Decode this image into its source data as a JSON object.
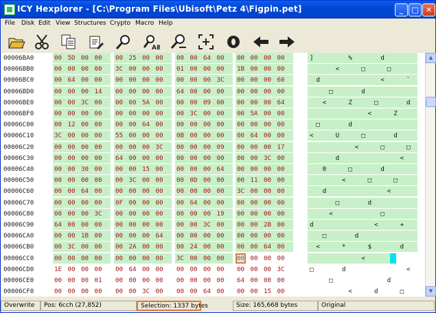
{
  "window": {
    "title": "ICY Hexplorer - [C:\\Program Files\\Ubisoft\\Petz 4\\Figpin.pet]"
  },
  "menu": [
    "File",
    "Disk",
    "Edit",
    "View",
    "Structures",
    "Crypto",
    "Macro",
    "Help"
  ],
  "toolbar": [
    "open-folder-icon",
    "cut-scissors-icon",
    "copy-pages-icon",
    "paste-icon",
    "search-icon",
    "replace-icon",
    "search-next-icon",
    "goto-offset-icon",
    "record-icon",
    "back-arrow-icon",
    "forward-arrow-icon"
  ],
  "colors": {
    "selection_bg": "#c8f0c8",
    "hex_text": "#a31414",
    "cursor": "#e07830",
    "caret": "#00e5f0"
  },
  "hex": {
    "rows": [
      {
        "addr": "00006BA0",
        "g": [
          [
            "00",
            "5D",
            "00",
            "00"
          ],
          [
            "00",
            "25",
            "00",
            "00"
          ],
          [
            "00",
            "00",
            "64",
            "00"
          ],
          [
            "00",
            "00",
            "00",
            "00"
          ]
        ],
        "a": [
          "]",
          "",
          "",
          "",
          "",
          "",
          "%",
          "",
          "",
          "",
          "",
          "d",
          "",
          "",
          "",
          ""
        ]
      },
      {
        "addr": "00006BB0",
        "g": [
          [
            "00",
            "00",
            "00",
            "00"
          ],
          [
            "3C",
            "00",
            "00",
            "00"
          ],
          [
            "01",
            "00",
            "00",
            "00"
          ],
          [
            "1B",
            "00",
            "00",
            "00"
          ]
        ],
        "a": [
          "",
          "",
          "",
          "",
          "<",
          "",
          "",
          "",
          "□",
          "",
          "",
          "",
          "□",
          "",
          "",
          ""
        ]
      },
      {
        "addr": "00006BC0",
        "g": [
          [
            "00",
            "64",
            "00",
            "00"
          ],
          [
            "00",
            "00",
            "00",
            "00"
          ],
          [
            "00",
            "00",
            "00",
            "3C"
          ],
          [
            "00",
            "00",
            "00",
            "60"
          ]
        ],
        "a": [
          "",
          "d",
          "",
          "",
          "",
          "",
          "",
          "",
          "",
          "",
          "",
          "<",
          "",
          "",
          "",
          "`"
        ]
      },
      {
        "addr": "00006BD0",
        "g": [
          [
            "00",
            "00",
            "00",
            "14"
          ],
          [
            "00",
            "00",
            "00",
            "00"
          ],
          [
            "64",
            "00",
            "00",
            "00"
          ],
          [
            "00",
            "00",
            "00",
            "00"
          ]
        ],
        "a": [
          "",
          "",
          "",
          "□",
          "",
          "",
          "",
          "",
          "d",
          "",
          "",
          "",
          "",
          "",
          "",
          ""
        ]
      },
      {
        "addr": "00006BE0",
        "g": [
          [
            "00",
            "00",
            "3C",
            "00"
          ],
          [
            "00",
            "00",
            "5A",
            "00"
          ],
          [
            "00",
            "00",
            "09",
            "00"
          ],
          [
            "00",
            "00",
            "00",
            "64"
          ]
        ],
        "a": [
          "",
          "",
          "<",
          "",
          "",
          "",
          "Z",
          "",
          "",
          "",
          "□",
          "",
          "",
          "",
          "",
          "d"
        ]
      },
      {
        "addr": "00006BF0",
        "g": [
          [
            "00",
            "00",
            "00",
            "00"
          ],
          [
            "00",
            "00",
            "00",
            "00"
          ],
          [
            "00",
            "3C",
            "00",
            "00"
          ],
          [
            "00",
            "5A",
            "00",
            "00"
          ]
        ],
        "a": [
          "",
          "",
          "",
          "",
          "",
          "",
          "",
          "",
          "",
          "<",
          "",
          "",
          "",
          "Z",
          "",
          ""
        ]
      },
      {
        "addr": "00006C00",
        "g": [
          [
            "00",
            "12",
            "00",
            "00"
          ],
          [
            "00",
            "00",
            "64",
            "00"
          ],
          [
            "00",
            "00",
            "00",
            "00"
          ],
          [
            "00",
            "00",
            "00",
            "00"
          ]
        ],
        "a": [
          "",
          "□",
          "",
          "",
          "",
          "",
          "d",
          "",
          "",
          "",
          "",
          "",
          "",
          "",
          "",
          ""
        ]
      },
      {
        "addr": "00006C10",
        "g": [
          [
            "3C",
            "00",
            "00",
            "00"
          ],
          [
            "55",
            "00",
            "00",
            "00"
          ],
          [
            "0B",
            "00",
            "00",
            "00"
          ],
          [
            "00",
            "64",
            "00",
            "00"
          ]
        ],
        "a": [
          "<",
          "",
          "",
          "",
          "U",
          "",
          "",
          "",
          "□",
          "",
          "",
          "",
          "",
          "d",
          "",
          ""
        ]
      },
      {
        "addr": "00006C20",
        "g": [
          [
            "00",
            "00",
            "00",
            "00"
          ],
          [
            "00",
            "00",
            "00",
            "3C"
          ],
          [
            "00",
            "00",
            "00",
            "09"
          ],
          [
            "00",
            "00",
            "00",
            "17"
          ]
        ],
        "a": [
          "",
          "",
          "",
          "",
          "",
          "",
          "",
          "<",
          "",
          "",
          "",
          "□",
          "",
          "",
          "",
          "□"
        ]
      },
      {
        "addr": "00006C30",
        "g": [
          [
            "00",
            "00",
            "00",
            "00"
          ],
          [
            "64",
            "00",
            "00",
            "00"
          ],
          [
            "00",
            "00",
            "00",
            "00"
          ],
          [
            "00",
            "00",
            "3C",
            "00"
          ]
        ],
        "a": [
          "",
          "",
          "",
          "",
          "d",
          "",
          "",
          "",
          "",
          "",
          "",
          "",
          "",
          "",
          "<",
          ""
        ]
      },
      {
        "addr": "00006C40",
        "g": [
          [
            "00",
            "00",
            "30",
            "00"
          ],
          [
            "00",
            "00",
            "15",
            "00"
          ],
          [
            "00",
            "00",
            "00",
            "64"
          ],
          [
            "00",
            "00",
            "00",
            "00"
          ]
        ],
        "a": [
          "",
          "",
          "0",
          "",
          "",
          "",
          "□",
          "",
          "",
          "",
          "",
          "d",
          "",
          "",
          "",
          ""
        ]
      },
      {
        "addr": "00006C50",
        "g": [
          [
            "00",
            "00",
            "00",
            "00"
          ],
          [
            "00",
            "3C",
            "00",
            "00"
          ],
          [
            "00",
            "0D",
            "00",
            "00"
          ],
          [
            "00",
            "11",
            "00",
            "00"
          ]
        ],
        "a": [
          "",
          "",
          "",
          "",
          "",
          "<",
          "",
          "",
          "",
          "□",
          "",
          "",
          "",
          "□",
          "",
          ""
        ]
      },
      {
        "addr": "00006C60",
        "g": [
          [
            "00",
            "00",
            "64",
            "00"
          ],
          [
            "00",
            "00",
            "00",
            "00"
          ],
          [
            "00",
            "00",
            "00",
            "00"
          ],
          [
            "3C",
            "00",
            "00",
            "00"
          ]
        ],
        "a": [
          "",
          "",
          "d",
          "",
          "",
          "",
          "",
          "",
          "",
          "",
          "",
          "",
          "<",
          "",
          "",
          ""
        ]
      },
      {
        "addr": "00006C70",
        "g": [
          [
            "00",
            "00",
            "00",
            "00"
          ],
          [
            "0F",
            "00",
            "00",
            "00"
          ],
          [
            "00",
            "64",
            "00",
            "00"
          ],
          [
            "00",
            "00",
            "00",
            "00"
          ]
        ],
        "a": [
          "",
          "",
          "",
          "",
          "□",
          "",
          "",
          "",
          "",
          "d",
          "",
          "",
          "",
          "",
          "",
          ""
        ]
      },
      {
        "addr": "00006C80",
        "g": [
          [
            "00",
            "00",
            "00",
            "3C"
          ],
          [
            "00",
            "00",
            "00",
            "00"
          ],
          [
            "00",
            "00",
            "00",
            "19"
          ],
          [
            "00",
            "00",
            "00",
            "00"
          ]
        ],
        "a": [
          "",
          "",
          "",
          "<",
          "",
          "",
          "",
          "",
          "",
          "",
          "",
          "□",
          "",
          "",
          "",
          ""
        ]
      },
      {
        "addr": "00006C90",
        "g": [
          [
            "64",
            "00",
            "00",
            "00"
          ],
          [
            "00",
            "00",
            "00",
            "00"
          ],
          [
            "00",
            "00",
            "3C",
            "00"
          ],
          [
            "00",
            "00",
            "2B",
            "00"
          ]
        ],
        "a": [
          "d",
          "",
          "",
          "",
          "",
          "",
          "",
          "",
          "",
          "",
          "<",
          "",
          "",
          "",
          "+",
          ""
        ]
      },
      {
        "addr": "00006CA0",
        "g": [
          [
            "00",
            "00",
            "1B",
            "00"
          ],
          [
            "00",
            "00",
            "00",
            "64"
          ],
          [
            "00",
            "00",
            "00",
            "00"
          ],
          [
            "00",
            "00",
            "00",
            "00"
          ]
        ],
        "a": [
          "",
          "",
          "□",
          "",
          "",
          "",
          "",
          "d",
          "",
          "",
          "",
          "",
          "",
          "",
          "",
          ""
        ]
      },
      {
        "addr": "00006CB0",
        "g": [
          [
            "00",
            "3C",
            "00",
            "00"
          ],
          [
            "00",
            "2A",
            "00",
            "00"
          ],
          [
            "00",
            "24",
            "00",
            "00"
          ],
          [
            "00",
            "00",
            "64",
            "00"
          ]
        ],
        "a": [
          "",
          "<",
          "",
          "",
          "",
          "*",
          "",
          "",
          "",
          "$",
          "",
          "",
          "",
          "",
          "d",
          ""
        ]
      },
      {
        "addr": "00006CC0",
        "g": [
          [
            "00",
            "00",
            "00",
            "00"
          ],
          [
            "00",
            "00",
            "00",
            "00"
          ],
          [
            "3C",
            "00",
            "00",
            "00"
          ],
          [
            "00",
            "00",
            "00",
            "00"
          ]
        ],
        "a": [
          "",
          "",
          "",
          "",
          "",
          "",
          "",
          "",
          "<",
          "",
          "",
          "",
          "",
          "",
          "",
          ""
        ]
      },
      {
        "addr": "00006CD0",
        "g": [
          [
            "1E",
            "00",
            "00",
            "00"
          ],
          [
            "00",
            "64",
            "00",
            "00"
          ],
          [
            "00",
            "00",
            "00",
            "00"
          ],
          [
            "00",
            "00",
            "00",
            "3C"
          ]
        ],
        "a": [
          "□",
          "",
          "",
          "",
          "",
          "d",
          "",
          "",
          "",
          "",
          "",
          "",
          "",
          "",
          "",
          "<"
        ]
      },
      {
        "addr": "00006CE0",
        "g": [
          [
            "00",
            "00",
            "00",
            "01"
          ],
          [
            "00",
            "00",
            "00",
            "00"
          ],
          [
            "00",
            "00",
            "00",
            "00"
          ],
          [
            "64",
            "00",
            "00",
            "00"
          ]
        ],
        "a": [
          "",
          "",
          "",
          "□",
          "",
          "",
          "",
          "",
          "",
          "",
          "",
          "",
          "d",
          "",
          "",
          ""
        ]
      },
      {
        "addr": "00006CF0",
        "g": [
          [
            "00",
            "00",
            "00",
            "00"
          ],
          [
            "00",
            "00",
            "3C",
            "00"
          ],
          [
            "00",
            "00",
            "64",
            "00"
          ],
          [
            "00",
            "00",
            "15",
            "00"
          ]
        ],
        "a": [
          "",
          "",
          "",
          "",
          "",
          "",
          "<",
          "",
          "",
          "",
          "d",
          "",
          "",
          "",
          "□",
          ""
        ]
      }
    ]
  },
  "status": {
    "mode": "Overwrite",
    "pos": "Pos: 6cch (27,852)",
    "selection": "Selection: 1337 bytes",
    "size": "Size: 165,668 bytes",
    "state": "Original"
  }
}
